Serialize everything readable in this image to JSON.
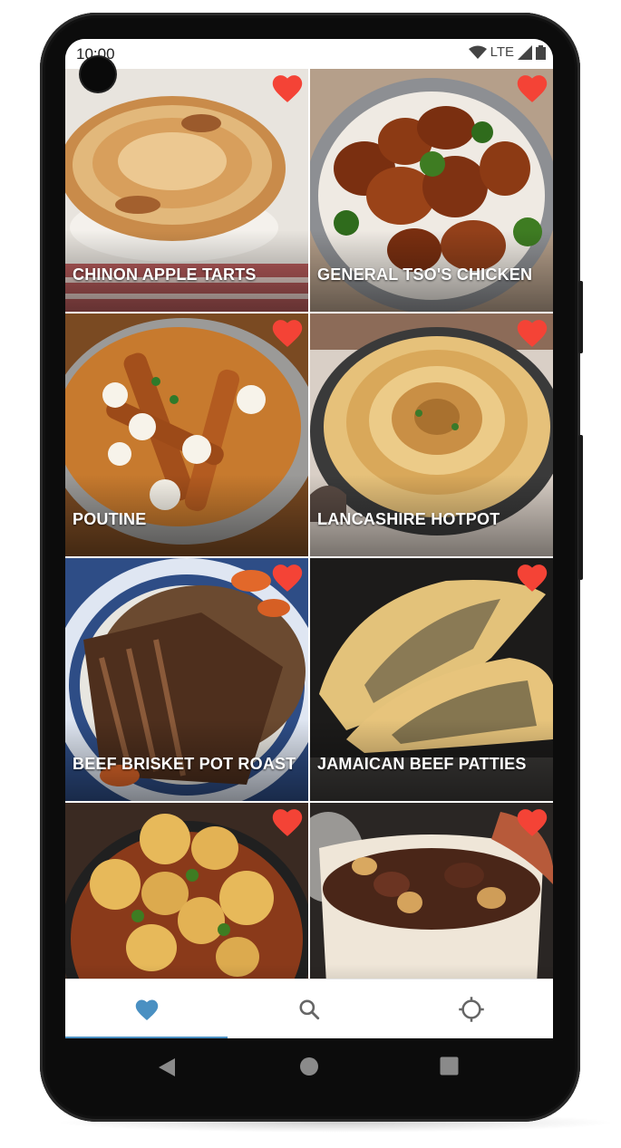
{
  "status_bar": {
    "time": "10:00",
    "network": "LTE"
  },
  "recipes": [
    {
      "name": "CHINON APPLE TARTS",
      "favorite": true
    },
    {
      "name": "GENERAL TSO'S CHICKEN",
      "favorite": true
    },
    {
      "name": "POUTINE",
      "favorite": true
    },
    {
      "name": "LANCASHIRE HOTPOT",
      "favorite": true
    },
    {
      "name": "BEEF BRISKET POT ROAST",
      "favorite": true
    },
    {
      "name": "JAMAICAN BEEF PATTIES",
      "favorite": true
    },
    {
      "name": "",
      "favorite": true
    },
    {
      "name": "",
      "favorite": true
    }
  ],
  "bottom_nav": {
    "selected": "favorites",
    "items": [
      {
        "id": "favorites",
        "icon": "heart-icon"
      },
      {
        "id": "search",
        "icon": "search-icon"
      },
      {
        "id": "locate",
        "icon": "crosshair-icon"
      }
    ]
  },
  "colors": {
    "favorite": "#f44336",
    "accent": "#4a90c2",
    "nav_icon": "#666666"
  }
}
